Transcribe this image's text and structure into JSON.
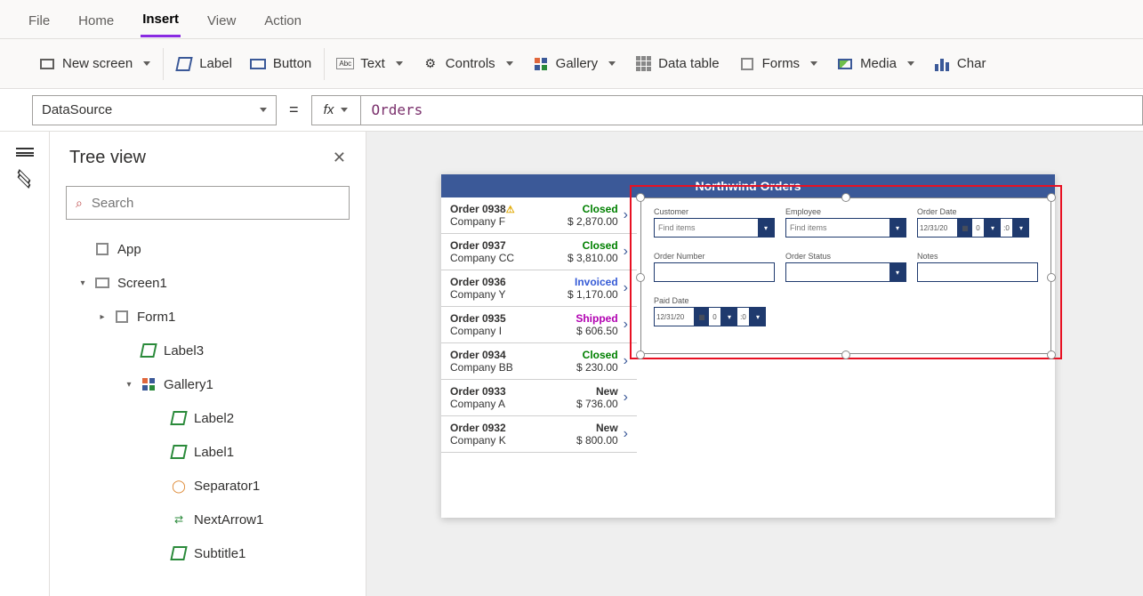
{
  "tabs": {
    "items": [
      "File",
      "Home",
      "Insert",
      "View",
      "Action"
    ],
    "active": "Insert"
  },
  "ribbon": {
    "newScreen": "New screen",
    "label": "Label",
    "button": "Button",
    "text": "Text",
    "controls": "Controls",
    "gallery": "Gallery",
    "dataTable": "Data table",
    "forms": "Forms",
    "media": "Media",
    "chart": "Char"
  },
  "formulaBar": {
    "property": "DataSource",
    "fx": "fx",
    "value": "Orders"
  },
  "treePanel": {
    "title": "Tree view",
    "searchPlaceholder": "Search",
    "items": [
      {
        "label": "App",
        "indent": 1,
        "caret": ""
      },
      {
        "label": "Screen1",
        "indent": 1,
        "caret": "▾"
      },
      {
        "label": "Form1",
        "indent": 2,
        "caret": "▸"
      },
      {
        "label": "Label3",
        "indent": 3,
        "caret": ""
      },
      {
        "label": "Gallery1",
        "indent": 3,
        "caret": "▾"
      },
      {
        "label": "Label2",
        "indent": 4,
        "caret": ""
      },
      {
        "label": "Label1",
        "indent": 4,
        "caret": ""
      },
      {
        "label": "Separator1",
        "indent": 4,
        "caret": ""
      },
      {
        "label": "NextArrow1",
        "indent": 4,
        "caret": ""
      },
      {
        "label": "Subtitle1",
        "indent": 4,
        "caret": ""
      }
    ]
  },
  "app": {
    "title": "Northwind Orders",
    "galleryRows": [
      {
        "order": "Order 0938",
        "warn": true,
        "company": "Company F",
        "status": "Closed",
        "amount": "$ 2,870.00"
      },
      {
        "order": "Order 0937",
        "company": "Company CC",
        "status": "Closed",
        "amount": "$ 3,810.00"
      },
      {
        "order": "Order 0936",
        "company": "Company Y",
        "status": "Invoiced",
        "amount": "$ 1,170.00"
      },
      {
        "order": "Order 0935",
        "company": "Company I",
        "status": "Shipped",
        "amount": "$ 606.50"
      },
      {
        "order": "Order 0934",
        "company": "Company BB",
        "status": "Closed",
        "amount": "$ 230.00"
      },
      {
        "order": "Order 0933",
        "company": "Company A",
        "status": "New",
        "amount": "$ 736.00"
      },
      {
        "order": "Order 0932",
        "company": "Company K",
        "status": "New",
        "amount": "$ 800.00"
      }
    ],
    "form": {
      "fields": [
        {
          "label": "Customer",
          "type": "dd",
          "value": "Find items"
        },
        {
          "label": "Employee",
          "type": "dd",
          "value": "Find items"
        },
        {
          "label": "Order Date",
          "type": "date",
          "value": "12/31/20"
        },
        {
          "label": "Order Number",
          "type": "text",
          "value": ""
        },
        {
          "label": "Order Status",
          "type": "dd",
          "value": ""
        },
        {
          "label": "Notes",
          "type": "text",
          "value": ""
        },
        {
          "label": "Paid Date",
          "type": "date",
          "value": "12/31/20"
        }
      ]
    }
  }
}
